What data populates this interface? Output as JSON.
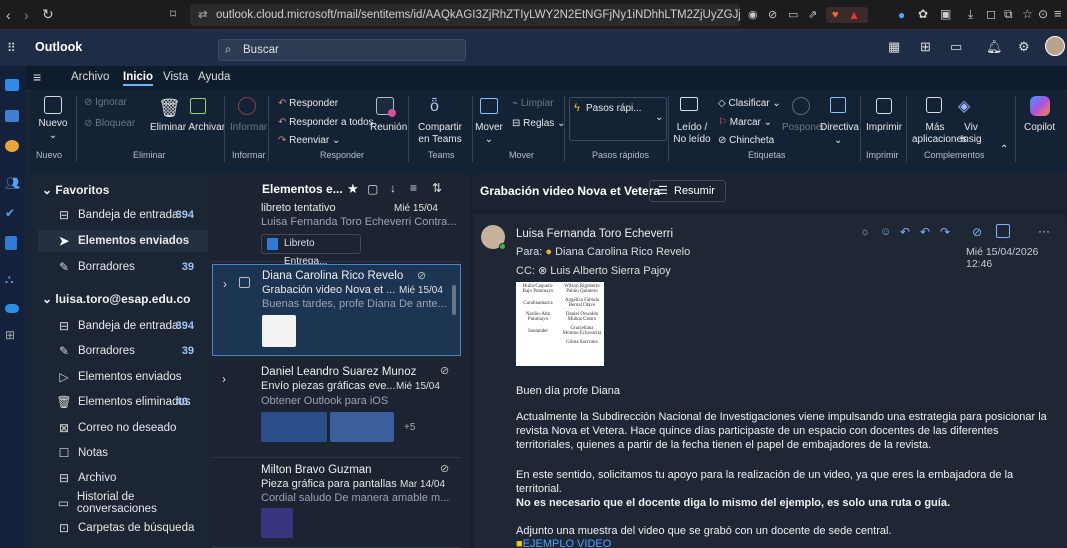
{
  "browser": {
    "url": "outlook.cloud.microsoft/mail/sentitems/id/AAQkAGI3ZjRhZTIyLWY2N2EtNGFjNy1iNDhhLTM2ZjUyZGJj..."
  },
  "app": {
    "name": "Outlook",
    "search_placeholder": "Buscar"
  },
  "tabs": [
    "Archivo",
    "Inicio",
    "Vista",
    "Ayuda"
  ],
  "ribbon": {
    "nuevo": "Nuevo",
    "ignorar": "Ignorar",
    "bloquear": "Bloquear",
    "eliminar_archivar": "Eliminar Archivar",
    "informar": "Informar",
    "responder": "Responder",
    "responder_todos": "Responder a todos",
    "reenviar": "Reenviar",
    "reunion": "Reunión",
    "compartir_teams": "Compartir en Teams",
    "mover": "Mover",
    "limpiar": "Limpiar",
    "reglas": "Reglas",
    "pasos_rapidos": "Pasos rápi...",
    "leido_no_leido": "Leído / No leído",
    "clasificar": "Clasificar",
    "marcar": "Marcar",
    "chincheta": "Chincheta",
    "posponer": "Posponer",
    "directiva": "Directiva",
    "imprimir": "Imprimir",
    "mas_aplicaciones": "Más aplicaciones",
    "viva_insights": "Viv Insig",
    "copilot": "Copilot",
    "groups": {
      "nuevo": "Nuevo",
      "eliminar": "Eliminar",
      "informar": "Informar",
      "responder": "Responder",
      "teams": "Teams",
      "mover": "Mover",
      "pasos_rapidos": "Pasos rápidos",
      "etiquetas": "Etiquetas",
      "imprimir": "Imprimir",
      "complementos": "Complementos"
    }
  },
  "folders": {
    "favoritos_title": "Favoritos",
    "favoritos": [
      {
        "label": "Bandeja de entrada",
        "count": "394"
      },
      {
        "label": "Elementos enviados",
        "count": ""
      },
      {
        "label": "Borradores",
        "count": "39"
      }
    ],
    "account_title": "luisa.toro@esap.edu.co",
    "account": [
      {
        "label": "Bandeja de entrada",
        "count": "394"
      },
      {
        "label": "Borradores",
        "count": "39"
      },
      {
        "label": "Elementos enviados",
        "count": ""
      },
      {
        "label": "Elementos eliminados",
        "count": "40"
      },
      {
        "label": "Correo no deseado",
        "count": ""
      },
      {
        "label": "Notas",
        "count": ""
      },
      {
        "label": "Archivo",
        "count": ""
      },
      {
        "label": "Historial de conversaciones",
        "count": ""
      },
      {
        "label": "Carpetas de búsqueda",
        "count": ""
      }
    ]
  },
  "list": {
    "title": "Elementos e...",
    "messages": [
      {
        "sender": "",
        "subject": "libreto tentativo",
        "date": "Mié 15/04",
        "preview": "Luisa Fernanda Toro Echeverri Contra...",
        "attachment": "Libreto Entrega..."
      },
      {
        "sender": "Diana Carolina Rico Revelo",
        "subject": "Grabación video Nova et ...",
        "date": "Mié 15/04",
        "preview": "Buenas tardes, profe Diana De ante..."
      },
      {
        "sender": "Daniel Leandro Suarez Munoz",
        "subject": "Envío piezas gráficas eve...",
        "date": "Mié 15/04",
        "preview": "Obtener Outlook para iOS",
        "more": "+5"
      },
      {
        "sender": "Milton Bravo Guzman",
        "subject": "Pieza gráfica para pantallas",
        "date": "Mar 14/04",
        "preview": "Cordial saludo De manera amable m..."
      }
    ]
  },
  "reading": {
    "subject": "Grabación video Nova et Vetera",
    "summarize": "Resumir",
    "from": "Luisa Fernanda Toro Echeverri",
    "to_label": "Para:",
    "to": "Diana Carolina Rico Revelo",
    "cc_label": "CC:",
    "cc": "Luis Alberto Sierra Pajoy",
    "datetime": "Mié 15/04/2026 12:46",
    "table_cells": [
      [
        "Huila-Caquetá- Bajo Putumayo",
        "Wilson Rigoberto Pabón Quintero"
      ],
      [
        "Cundinamarca",
        "Angélica Fabiola Bernal Otavo"
      ],
      [
        "Nariño-Alto Putumayo",
        "Daniel Oswaldo Muñoz Castro"
      ],
      [
        "Santander",
        "Gracieliana Moreno Echavarría"
      ],
      [
        "",
        "Gilma Saccomo"
      ]
    ],
    "greeting": "Buen día profe Diana",
    "para1": "Actualmente la Subdirección Nacional de Investigaciones viene impulsando una estrategia para posicionar la revista Nova et Vetera. Hace quince días participaste de un espacio con docentes de las diferentes territoriales, quienes a partir de la fecha tienen el papel de embajadores de la revista.",
    "para2": "En este sentido, solicitamos tu apoyo para la realización de un video, ya que eres la embajadora de la territorial.",
    "para2_bold": "No es necesario que el docente diga lo mismo del ejemplo, es solo una ruta o guía.",
    "para3": "Adjunto  una muestra del video que se grabó con un docente de sede central.",
    "link": "EJEMPLO VIDEO"
  }
}
